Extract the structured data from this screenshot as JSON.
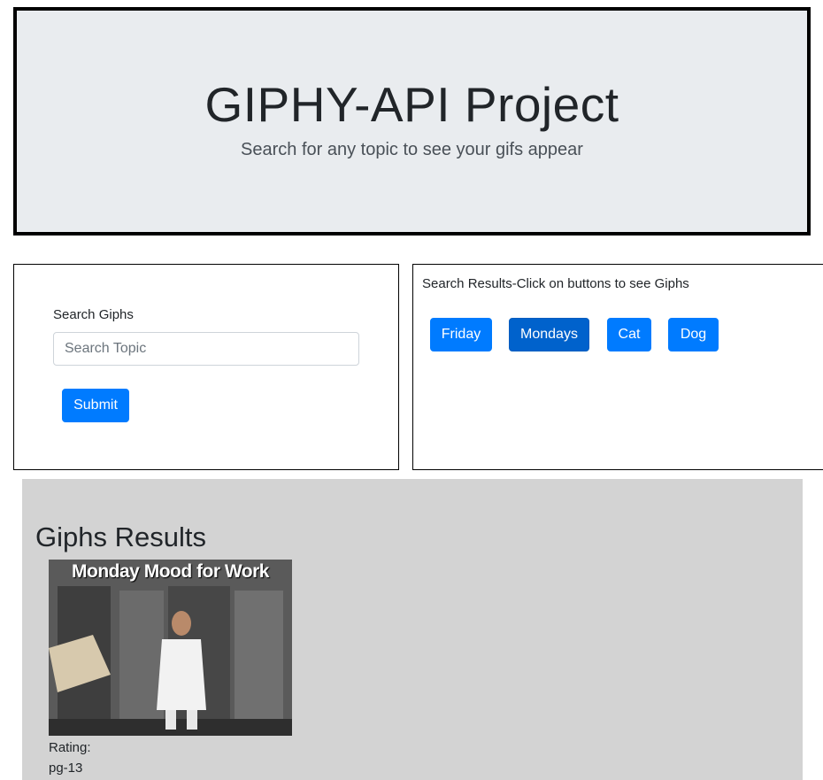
{
  "header": {
    "title": "GIPHY-API Project",
    "subtitle": "Search for any topic to see your gifs appear"
  },
  "search": {
    "label": "Search Giphs",
    "placeholder": "Search Topic",
    "submit_label": "Submit"
  },
  "results": {
    "title": "Search Results-Click on buttons to see Giphs",
    "buttons": [
      {
        "label": "Friday"
      },
      {
        "label": "Mondays"
      },
      {
        "label": "Cat"
      },
      {
        "label": "Dog"
      }
    ]
  },
  "giphs": {
    "heading": "Giphs Results",
    "items": [
      {
        "caption": "Monday Mood for Work",
        "rating_label": "Rating:",
        "rating": "pg-13"
      }
    ]
  },
  "colors": {
    "primary": "#007bff",
    "primary_active": "#0062cc",
    "jumbotron_bg": "#e9ecef",
    "results_bg": "#d3d3d3"
  }
}
